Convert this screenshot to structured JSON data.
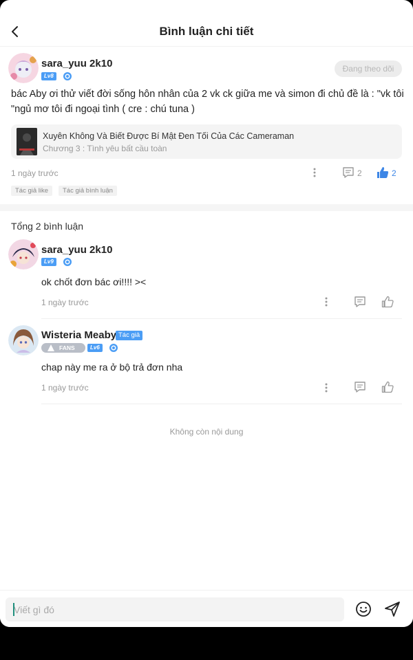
{
  "header": {
    "title": "Bình luận chi tiết"
  },
  "post": {
    "username": "sara_yuu 2k10",
    "level": "Lv8",
    "follow_label": "Đang theo dõi",
    "text": "bác Aby ơi thử viết đời sống hôn nhân của 2 vk ck giữa me và simon đi chủ đề là : \"vk tôi \"ngủ mơ tôi đi ngoại tình ( cre : chú tuna )",
    "book": {
      "title": "Xuyên Không Và Biết Được Bí Mật Đen Tối Của Các Cameraman",
      "chapter": "Chương 3 : Tình yêu bất cầu toàn"
    },
    "time": "1 ngày trước",
    "comment_count": "2",
    "like_count": "2",
    "chips": [
      "Tác giả like",
      "Tác giả bình luận"
    ]
  },
  "comments_section": {
    "total_label": "Tổng 2 bình luận",
    "comments": [
      {
        "username": "sara_yuu 2k10",
        "level": "Lv9",
        "text": "ok chốt đơn bác ơi!!!! ><",
        "time": "1 ngày trước"
      },
      {
        "username": "Wisteria Meaby",
        "author_tag": "Tác giả",
        "fans_label": "FANS",
        "level": "Lv6",
        "text": "chap này me ra ở bộ trả đơn nha",
        "time": "1 ngày trước"
      }
    ],
    "end_label": "Không còn nội dung"
  },
  "composer": {
    "placeholder": "Viết gì đó"
  },
  "colors": {
    "accent": "#4b9df5",
    "like_active": "#3d86e6",
    "muted": "#999999"
  }
}
